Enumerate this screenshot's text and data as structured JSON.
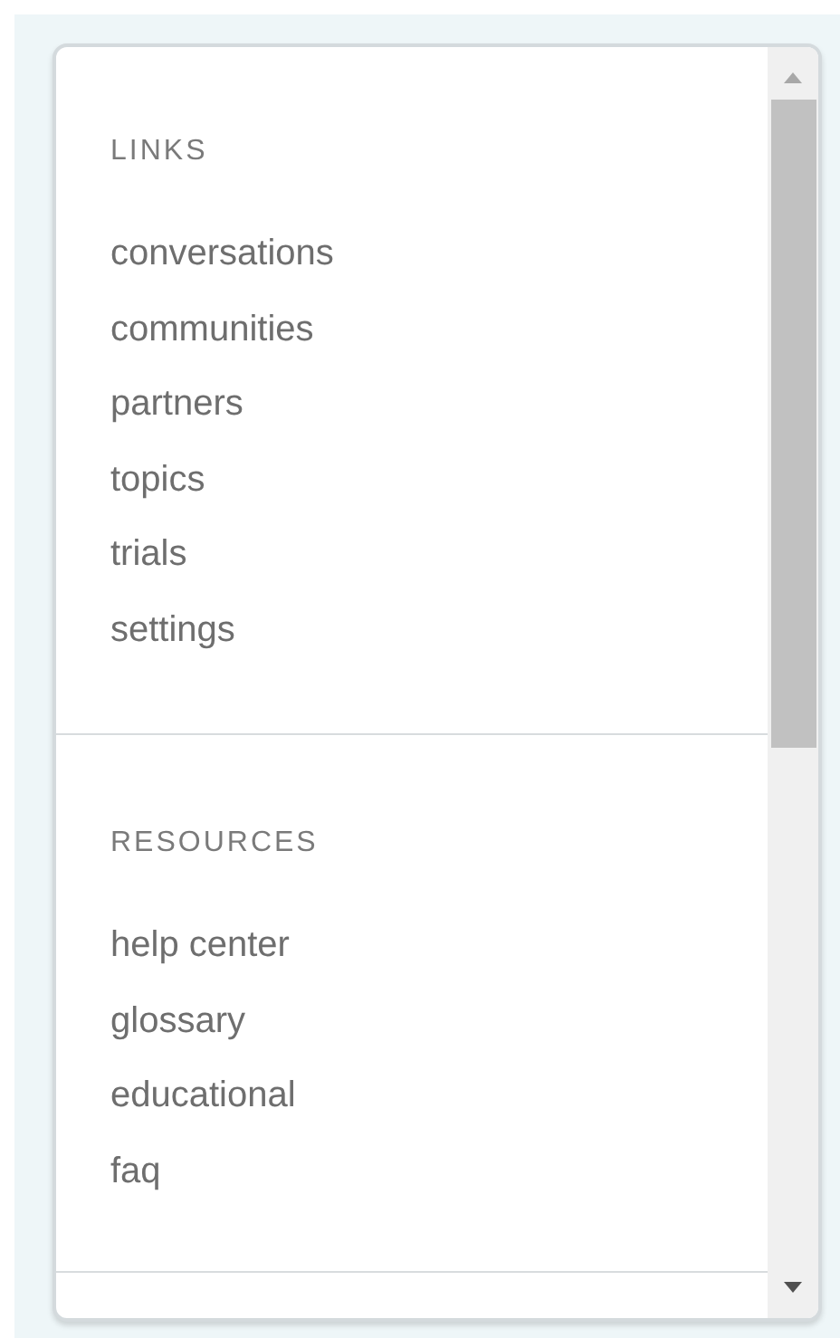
{
  "sections": [
    {
      "heading": "LINKS",
      "items": [
        "conversations",
        "communities",
        "partners",
        "topics",
        "trials",
        "settings"
      ]
    },
    {
      "heading": "RESOURCES",
      "items": [
        "help center",
        "glossary",
        "educational",
        "faq"
      ]
    }
  ]
}
